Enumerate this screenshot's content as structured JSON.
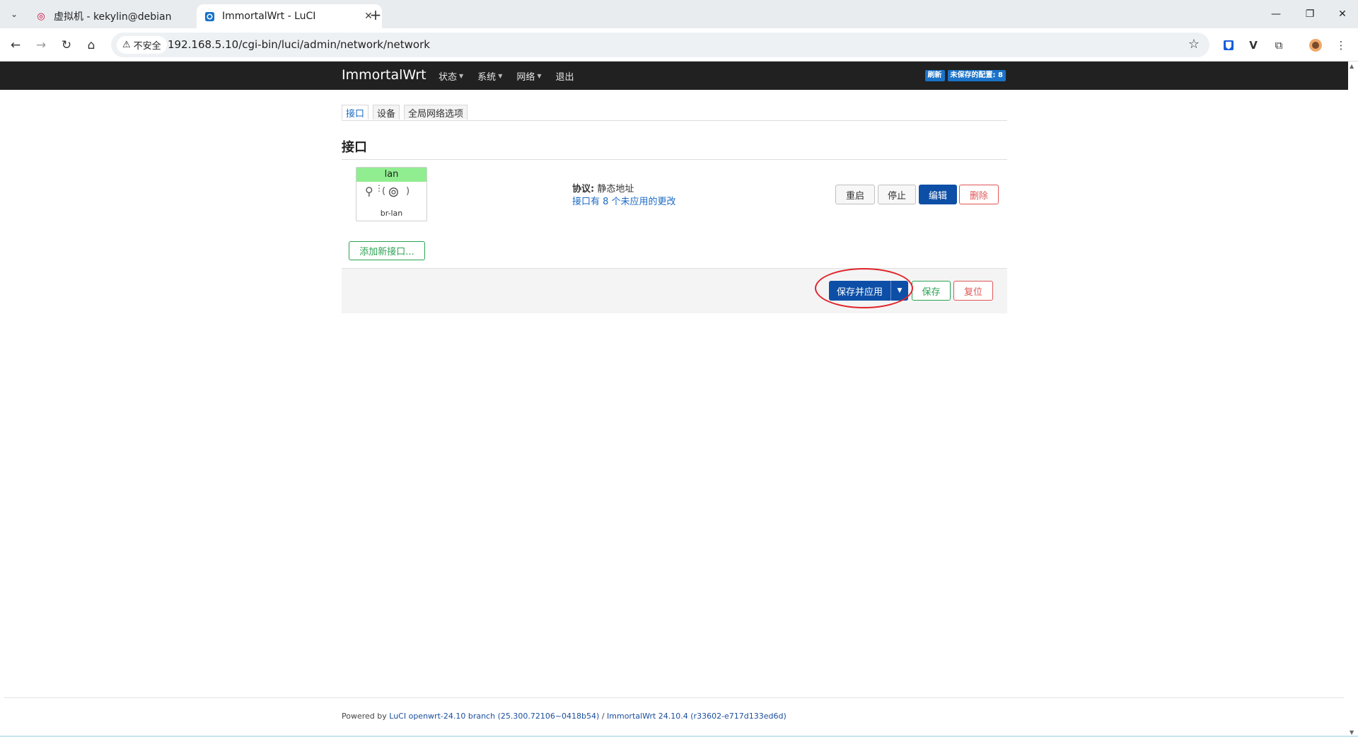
{
  "browser": {
    "tabs": [
      {
        "title": "虚拟机 - kekylin@debian",
        "icon": "debian-icon",
        "active": false
      },
      {
        "title": "ImmortalWrt - LuCI",
        "icon": "luci-icon",
        "active": true
      }
    ],
    "security_label": "不安全",
    "url": "192.168.5.10/cgi-bin/luci/admin/network/network"
  },
  "header": {
    "brand": "ImmortalWrt",
    "menu": [
      {
        "label": "状态",
        "dropdown": true
      },
      {
        "label": "系统",
        "dropdown": true
      },
      {
        "label": "网络",
        "dropdown": true
      },
      {
        "label": "退出",
        "dropdown": false
      }
    ],
    "indicators": [
      "刷新",
      "未保存的配置: 8"
    ]
  },
  "tabs": [
    "接口",
    "设备",
    "全局网络选项"
  ],
  "section": {
    "title": "接口",
    "interface": {
      "name": "lan",
      "device": "br-lan",
      "protocol_label": "协议:",
      "protocol_value": "静态地址",
      "pending_changes": "接口有 8 个未应用的更改",
      "head_color": "#90ee90"
    },
    "buttons": {
      "restart": "重启",
      "stop": "停止",
      "edit": "编辑",
      "delete": "删除"
    },
    "add_interface": "添加新接口..."
  },
  "actions": {
    "save_apply": "保存并应用",
    "save": "保存",
    "reset": "复位"
  },
  "footer": {
    "prefix": "Powered by ",
    "luci_link": "LuCI openwrt-24.10 branch (25.300.72106~0418b54)",
    "separator": " / ",
    "firmware_link": "ImmortalWrt 24.10.4 (r33602-e717d133ed6d)"
  },
  "colors": {
    "primary": "#0d4fa7",
    "header_bg": "#212121",
    "negative": "#e05555",
    "positive": "#2aa352",
    "annotation": "#e0242a"
  }
}
